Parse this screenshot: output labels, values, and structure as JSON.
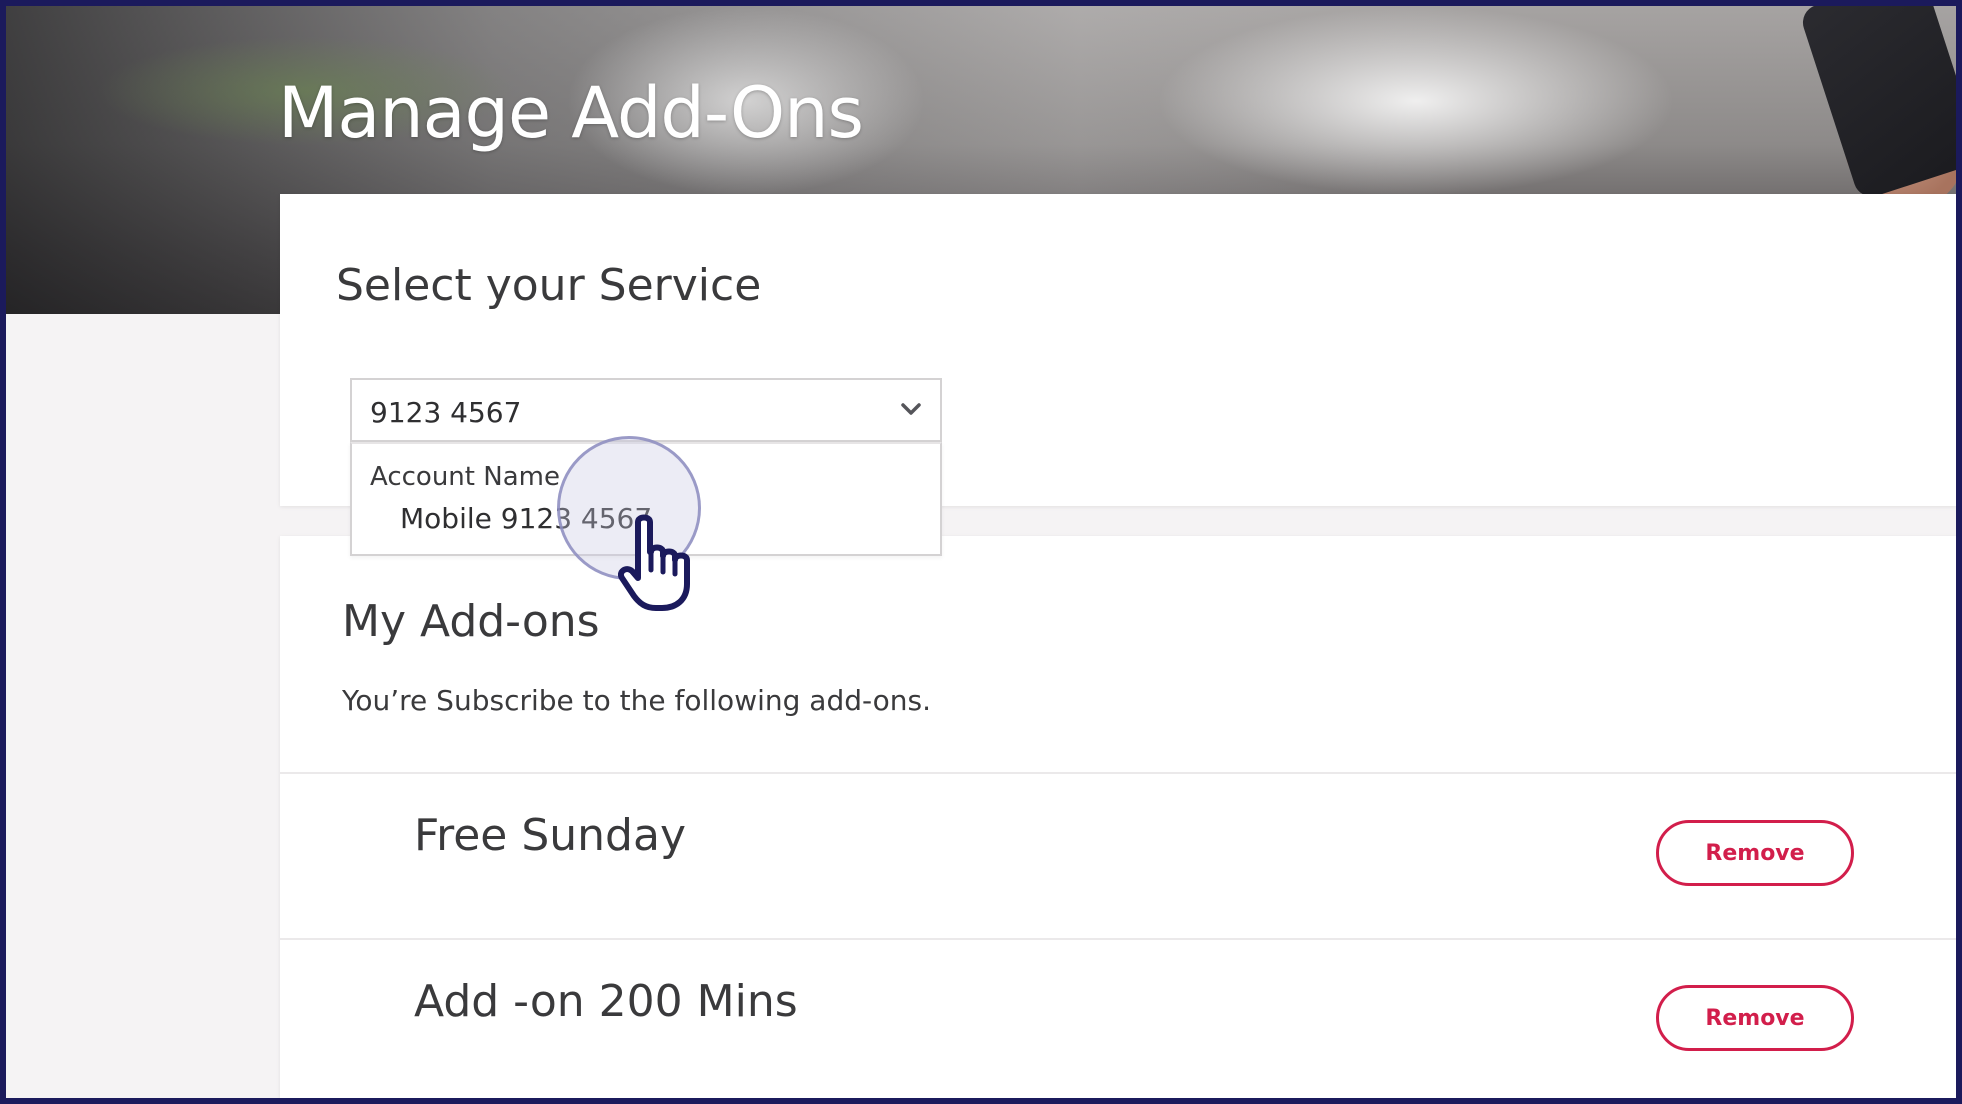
{
  "header": {
    "title": "Manage Add-Ons"
  },
  "service": {
    "heading": "Select your Service",
    "selected_value": "9123 4567",
    "dropdown": {
      "group_label": "Account Name",
      "options": [
        "Mobile 9123 4567"
      ]
    }
  },
  "addons": {
    "heading": "My Add-ons",
    "subtitle": "You’re Subscribe to the following add-ons.",
    "items": [
      {
        "name": "Free Sunday",
        "action_label": "Remove"
      },
      {
        "name": "Add -on 200 Mins",
        "action_label": "Remove"
      }
    ]
  },
  "colors": {
    "accent": "#d21e4b",
    "frame": "#1b1a5c",
    "text": "#3a3a3c",
    "background": "#f5f3f4"
  },
  "icons": {
    "select_chevron": "chevron-down-icon",
    "cursor": "hand-pointer-icon"
  }
}
